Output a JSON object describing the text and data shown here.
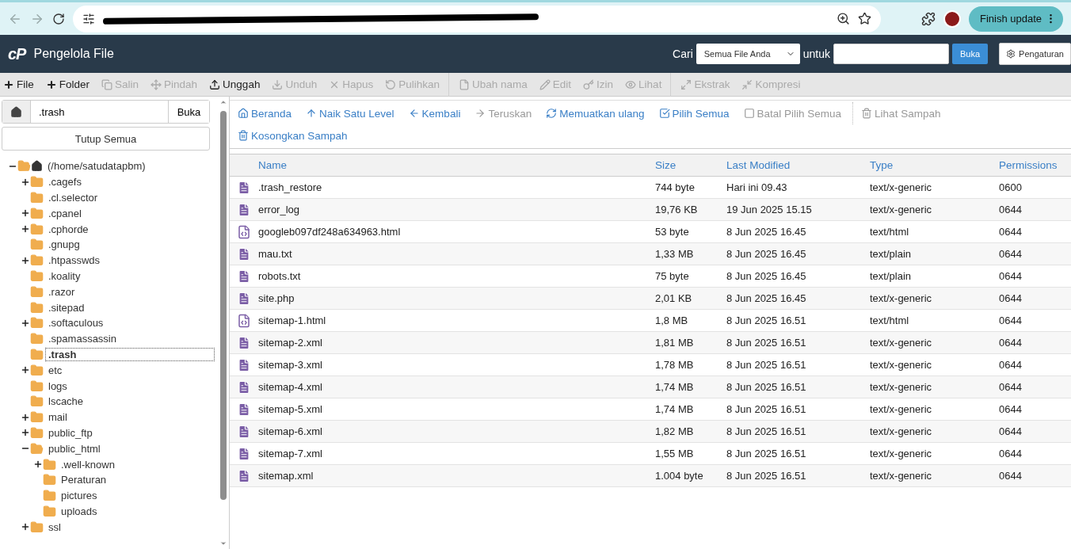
{
  "browser": {
    "update_button": "Finish update"
  },
  "header": {
    "logo": "cP",
    "title": "Pengelola File",
    "search_label": "Cari",
    "scope": "Semua File Anda",
    "for_label": "untuk",
    "go_button": "Buka",
    "settings_button": "Pengaturan"
  },
  "toolbar": [
    {
      "label": "File",
      "disabled": false
    },
    {
      "label": "Folder",
      "disabled": false
    },
    {
      "label": "Salin",
      "disabled": true
    },
    {
      "label": "Pindah",
      "disabled": true
    },
    {
      "label": "Unggah",
      "disabled": false
    },
    {
      "label": "Unduh",
      "disabled": true
    },
    {
      "label": "Hapus",
      "disabled": true
    },
    {
      "label": "Pulihkan",
      "disabled": true
    },
    {
      "label": "Ubah nama",
      "disabled": true
    },
    {
      "label": "Edit",
      "disabled": true
    },
    {
      "label": "Izin",
      "disabled": true
    },
    {
      "label": "Lihat",
      "disabled": true
    },
    {
      "label": "Ekstrak",
      "disabled": true
    },
    {
      "label": "Kompresi",
      "disabled": true
    }
  ],
  "sidebar": {
    "path": ".trash",
    "go_button": "Buka",
    "collapse_button": "Tutup Semua",
    "tree": [
      {
        "label": "(/home/satudatapbm)",
        "expandable": true,
        "expanded": true,
        "selected": false,
        "children": [
          {
            "label": ".cagefs",
            "expandable": true,
            "expanded": false,
            "selected": false
          },
          {
            "label": ".cl.selector",
            "expandable": false,
            "expanded": false,
            "selected": false
          },
          {
            "label": ".cpanel",
            "expandable": true,
            "expanded": false,
            "selected": false
          },
          {
            "label": ".cphorde",
            "expandable": true,
            "expanded": false,
            "selected": false
          },
          {
            "label": ".gnupg",
            "expandable": false,
            "expanded": false,
            "selected": false
          },
          {
            "label": ".htpasswds",
            "expandable": true,
            "expanded": false,
            "selected": false
          },
          {
            "label": ".koality",
            "expandable": false,
            "expanded": false,
            "selected": false
          },
          {
            "label": ".razor",
            "expandable": false,
            "expanded": false,
            "selected": false
          },
          {
            "label": ".sitepad",
            "expandable": false,
            "expanded": false,
            "selected": false
          },
          {
            "label": ".softaculous",
            "expandable": true,
            "expanded": false,
            "selected": false
          },
          {
            "label": ".spamassassin",
            "expandable": false,
            "expanded": false,
            "selected": false
          },
          {
            "label": ".trash",
            "expandable": false,
            "expanded": false,
            "selected": true
          },
          {
            "label": "etc",
            "expandable": true,
            "expanded": false,
            "selected": false
          },
          {
            "label": "logs",
            "expandable": false,
            "expanded": false,
            "selected": false
          },
          {
            "label": "lscache",
            "expandable": false,
            "expanded": false,
            "selected": false
          },
          {
            "label": "mail",
            "expandable": true,
            "expanded": false,
            "selected": false
          },
          {
            "label": "public_ftp",
            "expandable": true,
            "expanded": false,
            "selected": false
          },
          {
            "label": "public_html",
            "expandable": true,
            "expanded": true,
            "selected": false,
            "children": [
              {
                "label": ".well-known",
                "expandable": true,
                "expanded": false,
                "selected": false
              },
              {
                "label": "Peraturan",
                "expandable": false,
                "expanded": false,
                "selected": false
              },
              {
                "label": "pictures",
                "expandable": false,
                "expanded": false,
                "selected": false
              },
              {
                "label": "uploads",
                "expandable": false,
                "expanded": false,
                "selected": false
              }
            ]
          },
          {
            "label": "ssl",
            "expandable": true,
            "expanded": false,
            "selected": false
          }
        ]
      }
    ]
  },
  "actions": [
    {
      "label": "Beranda",
      "disabled": false
    },
    {
      "label": "Naik Satu Level",
      "disabled": false
    },
    {
      "label": "Kembali",
      "disabled": false
    },
    {
      "label": "Teruskan",
      "disabled": true
    },
    {
      "label": "Memuatkan ulang",
      "disabled": false
    },
    {
      "label": "Pilih Semua",
      "disabled": false
    },
    {
      "label": "Batal Pilih Semua",
      "disabled": true
    },
    {
      "label": "Lihat Sampah",
      "disabled": true
    },
    {
      "label": "Kosongkan Sampah",
      "disabled": false
    }
  ],
  "table": {
    "columns": [
      "Name",
      "Size",
      "Last Modified",
      "Type",
      "Permissions"
    ],
    "rows": [
      {
        "kind": "text",
        "cells": [
          ".trash_restore",
          "744 byte",
          "Hari ini 09.43",
          "text/x-generic",
          "0600"
        ]
      },
      {
        "kind": "text",
        "cells": [
          "error_log",
          "19,76 KB",
          "19 Jun 2025 15.15",
          "text/x-generic",
          "0644"
        ]
      },
      {
        "kind": "code",
        "cells": [
          "googleb097df248a634963.html",
          "53 byte",
          "8 Jun 2025 16.45",
          "text/html",
          "0644"
        ]
      },
      {
        "kind": "text",
        "cells": [
          "mau.txt",
          "1,33 MB",
          "8 Jun 2025 16.45",
          "text/plain",
          "0644"
        ]
      },
      {
        "kind": "text",
        "cells": [
          "robots.txt",
          "75 byte",
          "8 Jun 2025 16.45",
          "text/plain",
          "0644"
        ]
      },
      {
        "kind": "text",
        "cells": [
          "site.php",
          "2,01 KB",
          "8 Jun 2025 16.45",
          "text/x-generic",
          "0644"
        ]
      },
      {
        "kind": "code",
        "cells": [
          "sitemap-1.html",
          "1,8 MB",
          "8 Jun 2025 16.51",
          "text/html",
          "0644"
        ]
      },
      {
        "kind": "text",
        "cells": [
          "sitemap-2.xml",
          "1,81 MB",
          "8 Jun 2025 16.51",
          "text/x-generic",
          "0644"
        ]
      },
      {
        "kind": "text",
        "cells": [
          "sitemap-3.xml",
          "1,78 MB",
          "8 Jun 2025 16.51",
          "text/x-generic",
          "0644"
        ]
      },
      {
        "kind": "text",
        "cells": [
          "sitemap-4.xml",
          "1,74 MB",
          "8 Jun 2025 16.51",
          "text/x-generic",
          "0644"
        ]
      },
      {
        "kind": "text",
        "cells": [
          "sitemap-5.xml",
          "1,74 MB",
          "8 Jun 2025 16.51",
          "text/x-generic",
          "0644"
        ]
      },
      {
        "kind": "text",
        "cells": [
          "sitemap-6.xml",
          "1,82 MB",
          "8 Jun 2025 16.51",
          "text/x-generic",
          "0644"
        ]
      },
      {
        "kind": "text",
        "cells": [
          "sitemap-7.xml",
          "1,55 MB",
          "8 Jun 2025 16.51",
          "text/x-generic",
          "0644"
        ]
      },
      {
        "kind": "text",
        "cells": [
          "sitemap.xml",
          "1.004 byte",
          "8 Jun 2025 16.51",
          "text/x-generic",
          "0644"
        ]
      }
    ]
  }
}
